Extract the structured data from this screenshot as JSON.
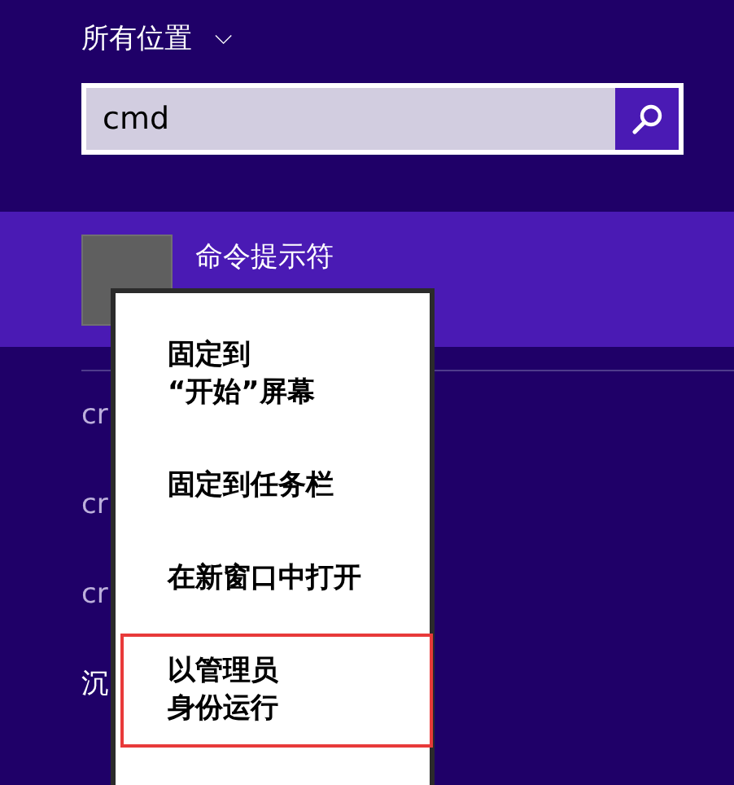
{
  "scope": {
    "label": "所有位置",
    "chevron": "⌵"
  },
  "search": {
    "value": "cmd"
  },
  "results": [
    {
      "name": "命令提示符",
      "selected": true,
      "kind": "app"
    },
    {
      "name": "cr",
      "selected": false,
      "kind": "text"
    },
    {
      "name": "cr",
      "selected": false,
      "kind": "text"
    },
    {
      "name": "cr",
      "selected": false,
      "kind": "text"
    },
    {
      "name": "沉",
      "selected": false,
      "kind": "text"
    }
  ],
  "context_menu": {
    "items": [
      {
        "lines": [
          "固定到",
          "“开始”屏幕"
        ],
        "highlighted": false
      },
      {
        "lines": [
          "固定到任务栏"
        ],
        "highlighted": false
      },
      {
        "lines": [
          "在新窗口中打开"
        ],
        "highlighted": false
      },
      {
        "lines": [
          "以管理员",
          "身份运行"
        ],
        "highlighted": true
      }
    ]
  }
}
